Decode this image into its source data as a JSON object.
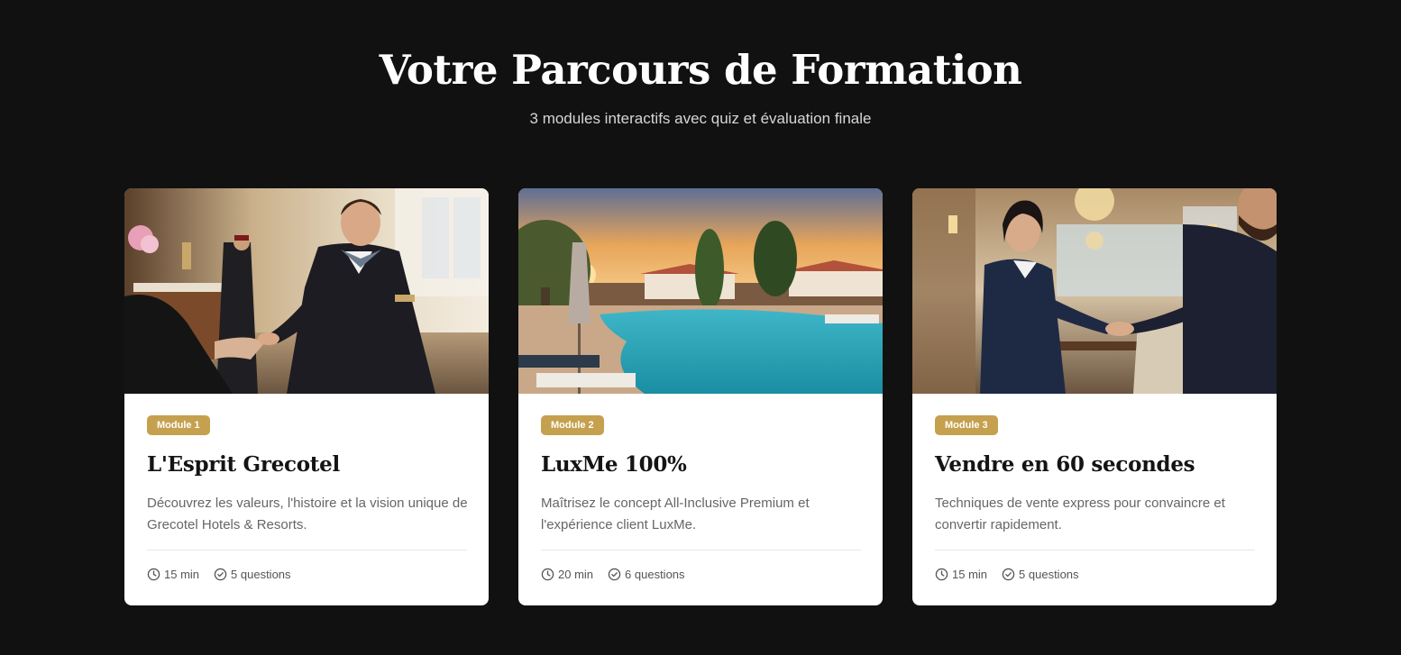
{
  "header": {
    "title": "Votre Parcours de Formation",
    "subtitle": "3 modules interactifs avec quiz et évaluation finale"
  },
  "colors": {
    "background": "#111111",
    "card": "#ffffff",
    "badge": "#c5a04e"
  },
  "modules": [
    {
      "badge": "Module 1",
      "title": "L'Esprit Grecotel",
      "description": "Découvrez les valeurs, l'histoire et la vision unique de Grecotel Hotels & Resorts.",
      "duration": "15 min",
      "questions": "5 questions",
      "image": "hotel-lobby-handshake-photo"
    },
    {
      "badge": "Module 2",
      "title": "LuxMe 100%",
      "description": "Maîtrisez le concept All-Inclusive Premium et l'expérience client LuxMe.",
      "duration": "20 min",
      "questions": "6 questions",
      "image": "resort-pool-sunset-photo"
    },
    {
      "badge": "Module 3",
      "title": "Vendre en 60 secondes",
      "description": "Techniques de vente express pour convaincre et convertir rapidement.",
      "duration": "15 min",
      "questions": "5 questions",
      "image": "business-handshake-lounge-photo"
    }
  ],
  "icons": {
    "duration": "clock-icon",
    "questions": "check-circle-icon"
  }
}
